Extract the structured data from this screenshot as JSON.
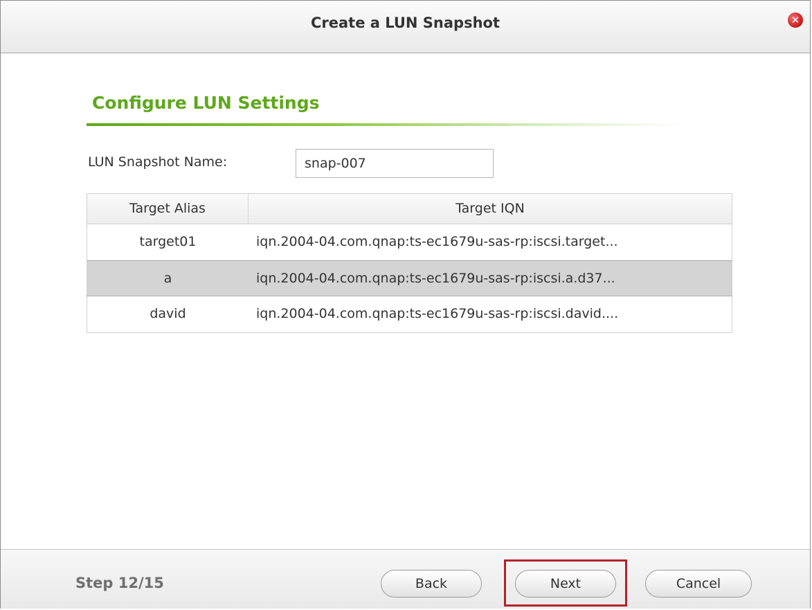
{
  "dialog": {
    "title": "Create a LUN Snapshot",
    "close_icon": "close-icon"
  },
  "section": {
    "title": "Configure LUN Settings"
  },
  "form": {
    "name_label": "LUN Snapshot Name:",
    "name_value": "snap-007"
  },
  "table": {
    "headers": [
      "Target Alias",
      "Target IQN"
    ],
    "rows": [
      {
        "alias": "target01",
        "iqn": "iqn.2004-04.com.qnap:ts-ec1679u-sas-rp:iscsi.target..."
      },
      {
        "alias": "a",
        "iqn": "iqn.2004-04.com.qnap:ts-ec1679u-sas-rp:iscsi.a.d37...",
        "selected": true
      },
      {
        "alias": "david",
        "iqn": "iqn.2004-04.com.qnap:ts-ec1679u-sas-rp:iscsi.david...."
      }
    ]
  },
  "footer": {
    "step": "Step 12/15",
    "back_label": "Back",
    "next_label": "Next",
    "cancel_label": "Cancel"
  },
  "colors": {
    "accent_green": "#5ea81c",
    "highlight_red": "#b3222a",
    "selected_row": "#d4d4d4"
  }
}
